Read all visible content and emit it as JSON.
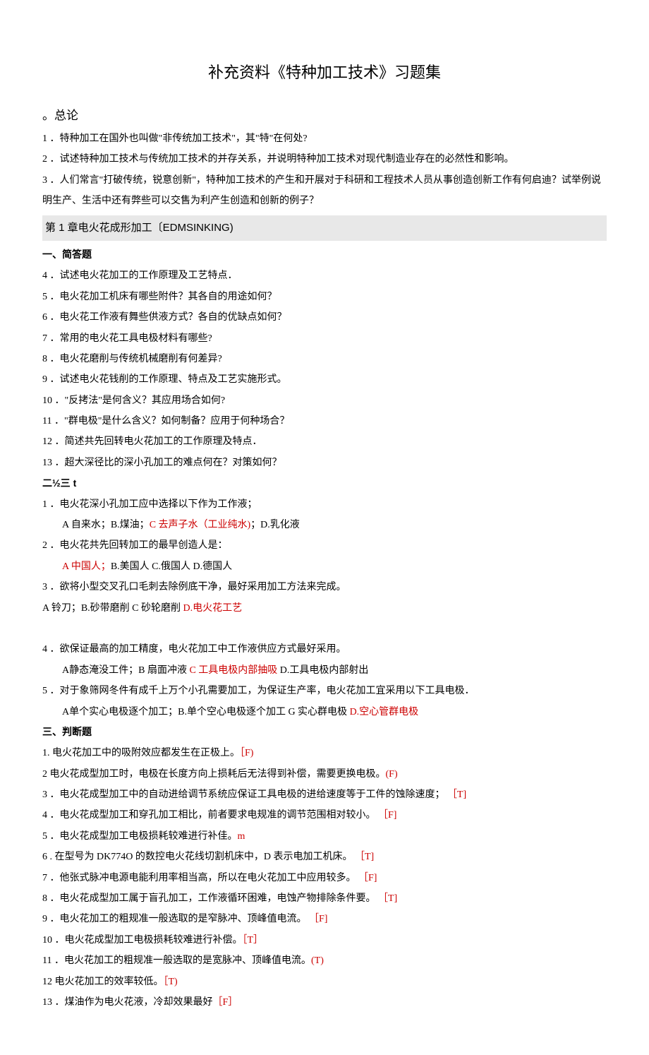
{
  "title": "补充资料《特种加工技术》习题集",
  "s0": {
    "heading": "。总论",
    "q1": "1 ．特种加工在国外也叫做\"非传统加工技术\"，其\"特\"在何处?",
    "q2": "2 ．试述特种加工技术与传统加工技术的并存关系，并说明特种加工技术对现代制造业存在的必然性和影响。",
    "q3": "3 ．人们常言\"打破传统，锐意创新\"，特种加工技术的产生和开展对于科研和工程技术人员从事创造创新工作有何启迪？试举例说明生产、生活中还有弊些可以交售为利产生创造和创新的例子？"
  },
  "s1": {
    "heading": "第 1 章电火花成形加工〔EDMSINKING)",
    "sub1": "一、简答题",
    "q4": "4 ．试述电火花加工的工作原理及工艺特点．",
    "q5": "5 ．电火花加工机床有哪些附件？其各自的用途如何？",
    "q6": "6 ．电火花工作液有舞些供液方式？各自的优缺点如何？",
    "q7": "7 ．常用的电火花工具电极材料有哪些?",
    "q8": "8 ．电火花磨削与传统机械磨削有何差异?",
    "q9": "9 ．试述电火花钱削的工作原理、特点及工艺实施形式。",
    "q10": "10 ．\"反拷法\"是何含义？其应用场合如何?",
    "q11": "11 ．\"群电极\"是什么含义？如何制备？应用于何种场合？",
    "q12": "12 ．简述共先回转电火花加工的工作原理及特点．",
    "q13": "13 ．超大深径比的深小孔加工的难点何在？对策如何？",
    "sub2": "二½三 t",
    "c1a": "1 ．电火花深小孔加工应中选择以下作为工作液；",
    "c1b": "A 自来水；B.煤油；",
    "c1r": "C 去声子水（工业纯水)",
    "c1c": "；D.乳化液",
    "c2a": "2 ．电火花共先回转加工的最早创造人是：",
    "c2r": "A 中国人；",
    "c2b": "B.美国人 C.俄国人 D.德国人",
    "c3a": "3 ．欲将小型交叉孔口毛刺去除例底干净，最好采用加工方法来完成。",
    "c3b": "A 铃刀；B.砂带磨削 C 砂轮磨削 ",
    "c3r": "D.电火花工艺",
    "c4a": "4 ．欲保证最高的加工精度，电火花加工中工作液供应方式最好采用。",
    "c4b": "A静态淹没工件；B 扇面冲液 ",
    "c4r": "C 工具电极内部抽吸 ",
    "c4c": "D.工具电极内部射出",
    "c5a": "5 ．对于象筛网冬件有成千上万个小孔需要加工，为保证生产率，电火花加工宜采用以下工具电极．",
    "c5b": "A单个实心电极逐个加工；B.单个空心电极逐个加工 G 实心群电极 ",
    "c5r": "D.空心管群电极",
    "sub3": "三、判断题",
    "j1a": "1. 电火花加工中的吸附效应都发生在正极上。",
    "j1r": "［F)",
    "j2a": "2 电火花成型加工时，电极在长度方向上损耗后无法得到补偿，需要更换电极。",
    "j2r": "(F)",
    "j3a": "3 ．电火花成型加工中的自动进给调节系统应保证工具电极的进给速度等于工件的蚀除速度；",
    "j3r": " ［T]",
    "j4a": "4 ．电火花成型加工和穿孔加工相比，前者要求电规准的调节范围相对较小。",
    "j4r": " ［F]",
    "j5a": "5 ．电火花成型加工电极损耗较难进行补佳。",
    "j5r": "m",
    "j6a": "6  . 在型号为 DK774O 的数控电火花线切割机床中，D 表示电加工机床。",
    "j6r": " ［T]",
    "j7a": "7 ．他张式脉冲电源电能利用率相当高，所以在电火花加工中应用较多。",
    "j7r": " ［F]",
    "j8a": "8 ．电火花成型加工属于盲孔加工，工作液循环困难，电蚀产物排除条件要。",
    "j8r": " ［T]",
    "j9a": "9 ．电火花加工的粗规准一般选取的是窄脉冲、顶峰值电流。",
    "j9r": " ［F]",
    "j10a": "10 ．电火花成型加工电极损耗较难进行补偿。",
    "j10r": "［T］",
    "j11a": "11 ．电火花加工的粗规准一般选取的是宽脉冲、顶峰值电流。",
    "j11r": "(T)",
    "j12a": "12 电火花加工的效率较低。",
    "j12r": "［T)",
    "j13a": "13 ．煤油作为电火花液，冷却效果最好",
    "j13r": "［F］"
  }
}
